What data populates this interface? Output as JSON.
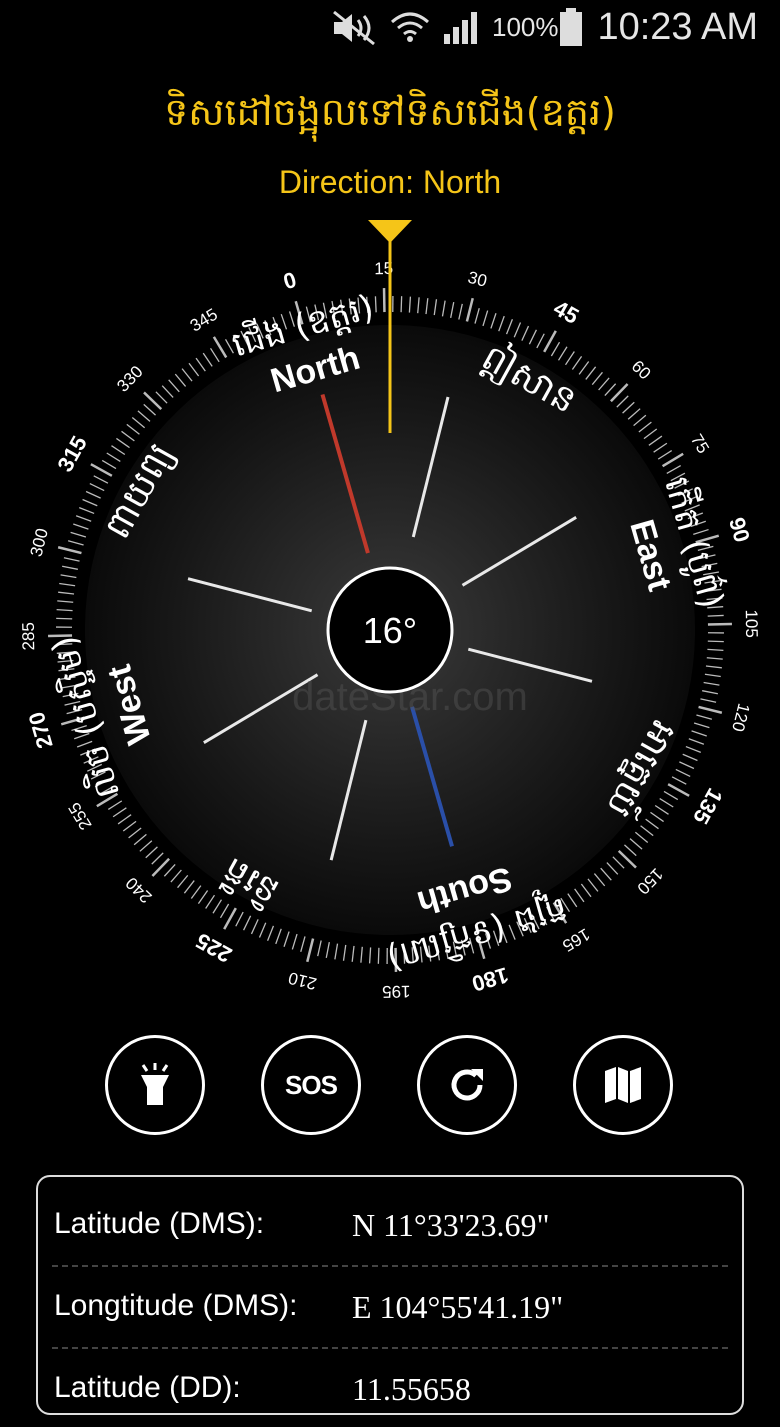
{
  "status_bar": {
    "battery": "100%",
    "time": "10:23 AM",
    "icons": [
      "mute-icon",
      "wifi-icon",
      "signal-icon",
      "battery-icon"
    ]
  },
  "header": {
    "khmer_title": "ទិសដៅចង្អុលទៅទិសជើង(ឧត្តរ)",
    "direction": "Direction: North"
  },
  "compass": {
    "heading": "16°",
    "degree_labels": [
      "0",
      "15",
      "30",
      "45",
      "60",
      "75",
      "90",
      "105",
      "120",
      "135",
      "150",
      "165",
      "180",
      "195",
      "210",
      "225",
      "240",
      "255",
      "270",
      "285",
      "300",
      "315",
      "330",
      "345"
    ],
    "cardinals": {
      "north": {
        "en": "North",
        "km": "ជើង (ឧត្តរ)"
      },
      "east": {
        "en": "East",
        "km": "កើត (បូព៌)"
      },
      "south": {
        "en": "South",
        "km": "ត្បូង (ទក្សិណ)"
      },
      "west": {
        "en": "West",
        "km": "លិច (បស្ចិម)"
      }
    },
    "intercardinals": {
      "ne": "ឦសាន",
      "se": "អាគ្នេយ៍",
      "sw": "និរតី",
      "nw": "ពាយព្យ"
    },
    "watermark": "dateStar.com",
    "colors": {
      "accent": "#f5c518",
      "north_needle": "#c0392b",
      "south_needle": "#2a4fa8"
    }
  },
  "buttons": {
    "flashlight_icon": "flashlight-icon",
    "sos_label": "SOS",
    "refresh_icon": "refresh-icon",
    "map_icon": "map-icon"
  },
  "info": {
    "rows": [
      {
        "label": "Latitude (DMS):",
        "value": "N 11°33'23.69\""
      },
      {
        "label": "Longtitude (DMS):",
        "value": "E 104°55'41.19\""
      },
      {
        "label": "Latitude (DD):",
        "value": "11.55658"
      }
    ]
  }
}
